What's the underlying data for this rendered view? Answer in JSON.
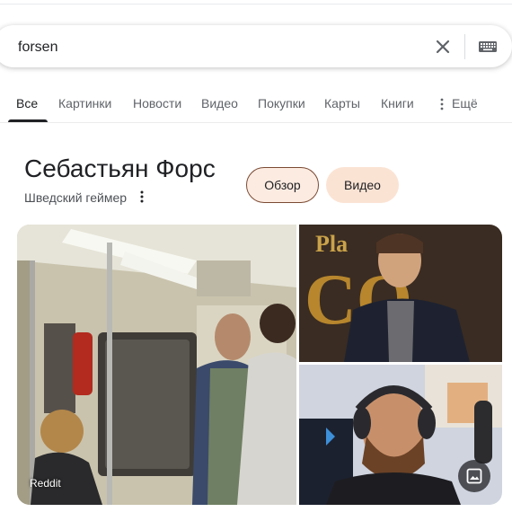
{
  "search": {
    "query": "forsen"
  },
  "icons": {
    "clear": "close-icon",
    "keyboard": "keyboard-icon",
    "more": "vertical-dots-icon",
    "image": "image-icon"
  },
  "tabs": [
    {
      "label": "Все",
      "active": true
    },
    {
      "label": "Картинки"
    },
    {
      "label": "Новости"
    },
    {
      "label": "Видео"
    },
    {
      "label": "Покупки"
    },
    {
      "label": "Карты"
    },
    {
      "label": "Книги"
    },
    {
      "label": "Ещё"
    }
  ],
  "knowledge_panel": {
    "title": "Себастьян Форс",
    "subtitle": "Шведский геймер",
    "chips": [
      "Обзор",
      "Видео"
    ],
    "images": {
      "main_source": "Reddit",
      "top_right_backdrop_text": "Pla CO"
    }
  },
  "colors": {
    "accent_chip_border": "#7a4a33",
    "chip_fill": "#fcebe1"
  }
}
